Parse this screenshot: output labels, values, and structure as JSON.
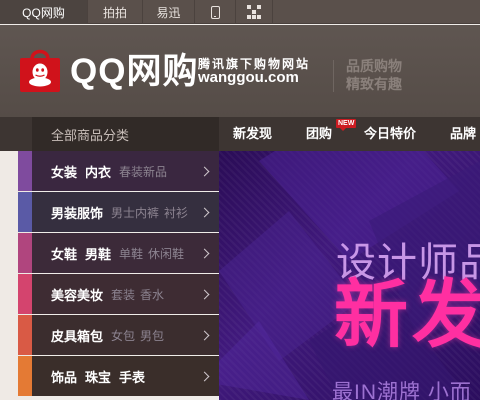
{
  "topbar": {
    "brand": "QQ网购",
    "paipai": "拍拍",
    "yixun": "易迅"
  },
  "header": {
    "logo_text": "QQ网购",
    "sub_cn": "腾讯旗下购物网站",
    "sub_en": "wanggou.com",
    "slogan": "品质购物 精致有趣"
  },
  "nav": {
    "category_header": "全部商品分类",
    "links": [
      "新发现",
      "团购",
      "今日特价",
      "品牌"
    ],
    "new_badge": "NEW"
  },
  "categories": [
    {
      "main": [
        "女装",
        "内衣"
      ],
      "sub": [
        "春装新品"
      ],
      "accent": "#7f4b9e"
    },
    {
      "main": [
        "男装服饰"
      ],
      "sub": [
        "男士内裤",
        "衬衫"
      ],
      "accent": "#5a5aa6"
    },
    {
      "main": [
        "女鞋",
        "男鞋"
      ],
      "sub": [
        "单鞋",
        "休闲鞋"
      ],
      "accent": "#b0457e"
    },
    {
      "main": [
        "美容美妆"
      ],
      "sub": [
        "套装",
        "香水"
      ],
      "accent": "#d4446e"
    },
    {
      "main": [
        "皮具箱包"
      ],
      "sub": [
        "女包",
        "男包"
      ],
      "accent": "#d95a45"
    },
    {
      "main": [
        "饰品",
        "珠宝",
        "手表"
      ],
      "sub": [],
      "accent": "#e47a34"
    }
  ],
  "banner": {
    "line1": "设计师品",
    "line2": "新发",
    "line3": "最IN潮牌 小而"
  },
  "colors": {
    "brand_red": "#d0121b",
    "banner_pink": "#ff2fa1",
    "header_bg": "#5a514c"
  }
}
